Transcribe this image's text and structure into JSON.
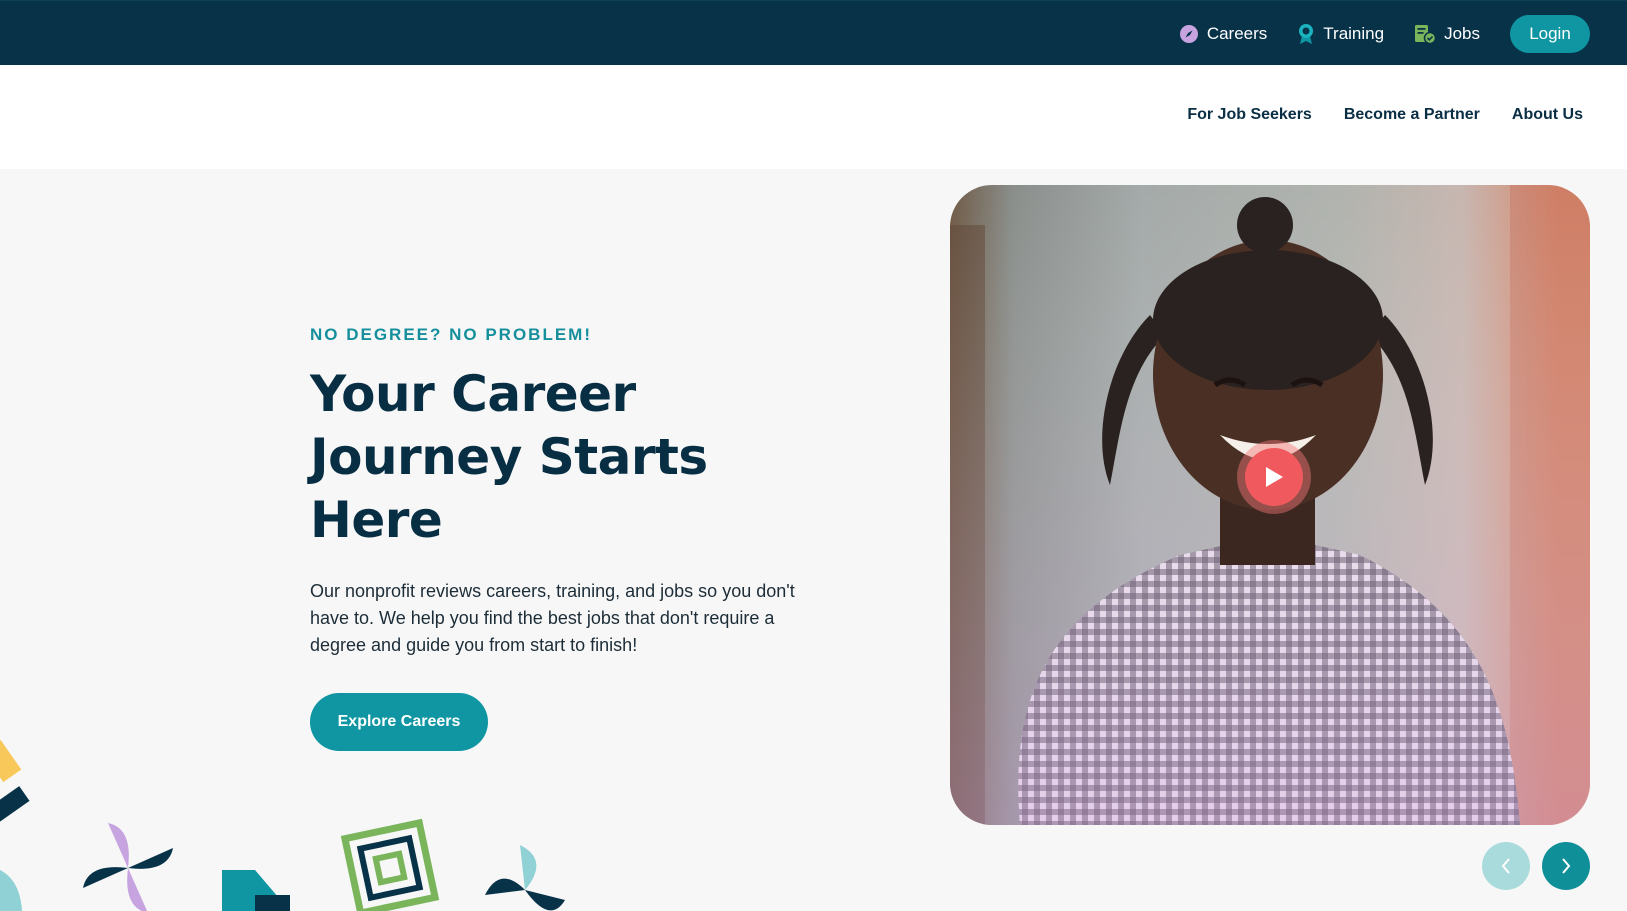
{
  "topnav": {
    "careers": "Careers",
    "training": "Training",
    "jobs": "Jobs",
    "login": "Login"
  },
  "mainnav": {
    "job_seekers": "For Job Seekers",
    "partner": "Become a Partner",
    "about": "About Us"
  },
  "hero": {
    "eyebrow": "NO DEGREE? NO PROBLEM!",
    "headline": "Your Career Journey Starts Here",
    "description": "Our nonprofit reviews careers, training, and jobs so you don't have to. We help you find the best jobs that don't require a degree and guide you from start to finish!",
    "cta": "Explore Careers"
  },
  "icons": {
    "careers": "compass-icon",
    "training": "award-ribbon-icon",
    "jobs": "job-document-check-icon",
    "play": "play-icon",
    "prev": "chevron-left-icon",
    "next": "chevron-right-icon"
  },
  "colors": {
    "navy": "#073248",
    "teal": "#0f96a2",
    "play_red": "#f05a5e",
    "purple": "#c7a4e0",
    "green": "#7ab55c",
    "yellow": "#f8c85a"
  }
}
